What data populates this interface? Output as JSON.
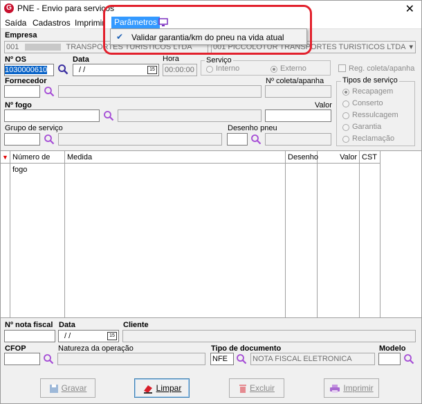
{
  "window": {
    "title": "PNE - Envio para serviços",
    "app_icon": "G",
    "close": "✕"
  },
  "menu": {
    "items": [
      "Saída",
      "Cadastros",
      "Imprimir"
    ],
    "active": "Parâmetros",
    "dropdown_item": "Validar garantia/km do pneu na vida atual"
  },
  "empresa": {
    "label": "Empresa",
    "code": "001",
    "name": "TRANSPORTES TURISTICOS LTDA",
    "right": "001 PICCOLOTUR TRANSPORTES TURISTICOS LTDA"
  },
  "os": {
    "label": "Nº  OS",
    "value": "1030000610"
  },
  "data": {
    "label": "Data",
    "value": "/ /",
    "cal": "15"
  },
  "hora": {
    "label": "Hora",
    "value": "00:00:00"
  },
  "servico": {
    "label": "Serviço",
    "interno": "Interno",
    "externo": "Externo"
  },
  "reg_coleta": {
    "label": "Reg. coleta/apanha"
  },
  "fornecedor": {
    "label": "Fornecedor"
  },
  "coleta": {
    "label": "Nº coleta/apanha"
  },
  "tipos": {
    "label": "Tipos de serviço",
    "items": [
      "Recapagem",
      "Conserto",
      "Ressulcagem",
      "Garantia",
      "Reclamação"
    ]
  },
  "fogo": {
    "label": "Nº  fogo"
  },
  "valor": {
    "label": "Valor"
  },
  "grupo": {
    "label": "Grupo de serviço"
  },
  "desenho": {
    "label": "Desenho pneu"
  },
  "table": {
    "columns": [
      "Número de fogo",
      "Medida",
      "Desenho",
      "Valor",
      "CST"
    ]
  },
  "nota": {
    "label": "Nº nota fiscal",
    "data_label": "Data",
    "data_value": "/ /",
    "cal": "15",
    "cliente_label": "Cliente"
  },
  "cfop": {
    "label": "CFOP",
    "natureza_label": "Natureza da operação",
    "tipo_label": "Tipo de documento",
    "tipo_code": "NFE",
    "tipo_desc": "NOTA FISCAL ELETRONICA",
    "modelo_label": "Modelo"
  },
  "buttons": {
    "gravar": "Gravar",
    "limpar": "Limpar",
    "excluir": "Excluir",
    "imprimir": "Imprimir"
  }
}
